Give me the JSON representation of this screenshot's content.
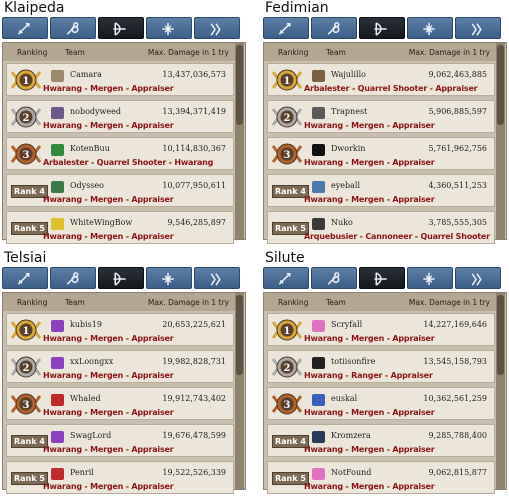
{
  "header_labels": {
    "ranking": "Ranking",
    "team": "Team",
    "damage": "Max. Damage in 1 try"
  },
  "colors": {
    "class_text": "#8b1515",
    "gold": "#d9a63a",
    "silver": "#a9a9a9",
    "bronze": "#b0612c",
    "tab": "#4a6d96",
    "tab_active": "#1d2127"
  },
  "tabs": [
    {
      "icon": "sword-icon",
      "active": false
    },
    {
      "icon": "staff-icon",
      "active": false
    },
    {
      "icon": "bow-icon",
      "active": true
    },
    {
      "icon": "cleric-icon",
      "active": false
    },
    {
      "icon": "scout-icon",
      "active": false
    }
  ],
  "panels": [
    {
      "server": "Klaipeda",
      "rows": [
        {
          "rank": "1",
          "team": "Camara",
          "damage": "13,437,036,573",
          "classes": "Hwarang - Mergen - Appraiser",
          "icon": "flame-emblem-icon"
        },
        {
          "rank": "2",
          "team": "nobodyweed",
          "damage": "13,394,371,419",
          "classes": "Hwarang - Mergen - Appraiser",
          "icon": "tentacle-emblem-icon"
        },
        {
          "rank": "3",
          "team": "KotenBuu",
          "damage": "10,114,830,367",
          "classes": "Arbalester - Quarrel Shooter - Hwarang",
          "icon": "swirl-emblem-icon"
        },
        {
          "rank": "Rank 4",
          "team": "Odysseo",
          "damage": "10,077,950,611",
          "classes": "Hwarang - Mergen - Appraiser",
          "icon": "globe-emblem-icon"
        },
        {
          "rank": "Rank 5",
          "team": "WhiteWingBow",
          "damage": "9,546,285,897",
          "classes": "Hwarang - Mergen - Appraiser",
          "icon": "sunglasses-emblem-icon"
        }
      ]
    },
    {
      "server": "Fedimian",
      "rows": [
        {
          "rank": "1",
          "team": "Wajulillo",
          "damage": "9,062,463,885",
          "classes": "Arbalester - Quarrel Shooter - Appraiser",
          "icon": "hat-emblem-icon"
        },
        {
          "rank": "2",
          "team": "Trapnest",
          "damage": "5,906,885,597",
          "classes": "Hwarang - Mergen - Appraiser",
          "icon": "pistol-emblem-icon"
        },
        {
          "rank": "3",
          "team": "Dworkin",
          "damage": "5,761,962,756",
          "classes": "Hwarang - Mergen - Appraiser",
          "icon": "moon-emblem-icon"
        },
        {
          "rank": "Rank 4",
          "team": "eyeball",
          "damage": "4,360,511,253",
          "classes": "Hwarang - Mergen - Appraiser",
          "icon": "face-emblem-icon"
        },
        {
          "rank": "Rank 5",
          "team": "Nuko",
          "damage": "3,785,555,305",
          "classes": "Arquebusier - Cannoneer - Quarrel Shooter",
          "icon": "cat-emblem-icon"
        }
      ]
    },
    {
      "server": "Telsiai",
      "rows": [
        {
          "rank": "1",
          "team": "kubis19",
          "damage": "20,653,225,621",
          "classes": "Hwarang - Mergen - Appraiser",
          "icon": "purple-dragon-emblem-icon"
        },
        {
          "rank": "2",
          "team": "xxLoongxx",
          "damage": "19,982,828,731",
          "classes": "Hwarang - Mergen - Appraiser",
          "icon": "purple-dragon-emblem-icon"
        },
        {
          "rank": "3",
          "team": "Whaled",
          "damage": "19,912,743,402",
          "classes": "Hwarang - Mergen - Appraiser",
          "icon": "red-bird-emblem-icon"
        },
        {
          "rank": "Rank 4",
          "team": "SwagLord",
          "damage": "19,676,478,599",
          "classes": "Hwarang - Mergen - Appraiser",
          "icon": "purple-dragon-emblem-icon"
        },
        {
          "rank": "Rank 5",
          "team": "Penril",
          "damage": "19,522,526,339",
          "classes": "Hwarang - Mergen - Appraiser",
          "icon": "red-bird-emblem-icon"
        }
      ]
    },
    {
      "server": "Silute",
      "rows": [
        {
          "rank": "1",
          "team": "Scryfall",
          "damage": "14,227,169,646",
          "classes": "Hwarang - Mergen - Appraiser",
          "icon": "pink-creature-emblem-icon"
        },
        {
          "rank": "2",
          "team": "totiisonfire",
          "damage": "13,545,158,793",
          "classes": "Hwarang - Ranger - Appraiser",
          "icon": "top-hat-emblem-icon"
        },
        {
          "rank": "3",
          "team": "euskal",
          "damage": "10,362,561,259",
          "classes": "Hwarang - Mergen - Appraiser",
          "icon": "blue-crest-emblem-icon"
        },
        {
          "rank": "Rank 4",
          "team": "Kromzera",
          "damage": "9,285,788,400",
          "classes": "Hwarang - Mergen - Appraiser",
          "icon": "shield-emblem-icon"
        },
        {
          "rank": "Rank 5",
          "team": "NotFound",
          "damage": "9,062,815,877",
          "classes": "Hwarang - Mergen - Appraiser",
          "icon": "pink-creature-emblem-icon"
        }
      ]
    }
  ]
}
